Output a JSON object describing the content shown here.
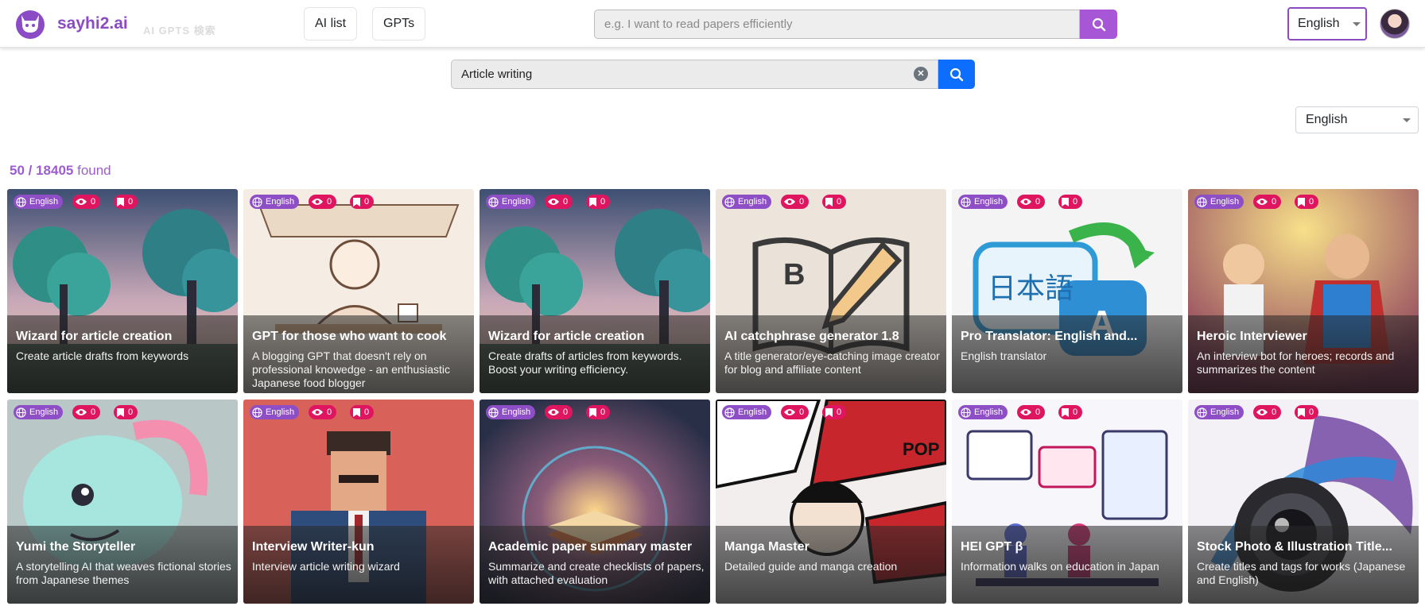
{
  "header": {
    "brand": "sayhi2.ai",
    "ghost_text": "AI GPTS 検索",
    "nav": [
      "AI list",
      "GPTs"
    ],
    "search_placeholder": "e.g. I want to read papers efficiently",
    "language": "English"
  },
  "search": {
    "query": "Article writing",
    "language": "English"
  },
  "results": {
    "shown": "50 / 18405",
    "suffix": "found"
  },
  "colors": {
    "brand": "#8b4bc5",
    "primary": "#0d6efd",
    "badge_pink": "#e0155f",
    "badge_purple": "#8e4ec6"
  },
  "cards": [
    {
      "lang": "English",
      "views": "0",
      "saves": "0",
      "title": "Wizard for article creation",
      "desc": "Create article drafts from keywords",
      "art": "forest-dusk"
    },
    {
      "lang": "English",
      "views": "0",
      "saves": "0",
      "title": "GPT for those who want to cook",
      "desc": "A blogging GPT that doesn't rely on professional knowedge - an enthusiastic Japanese food blogger",
      "art": "sketch-writer"
    },
    {
      "lang": "English",
      "views": "0",
      "saves": "0",
      "title": "Wizard for article creation",
      "desc": "Create drafts of articles from keywords. Boost your writing efficiency.",
      "art": "forest-dusk"
    },
    {
      "lang": "English",
      "views": "0",
      "saves": "0",
      "title": "AI catchphrase generator 1.8",
      "desc": "A title generator/eye-catching image creator for blog and affiliate content",
      "art": "book-pencil"
    },
    {
      "lang": "English",
      "views": "0",
      "saves": "0",
      "title": "Pro Translator: English and...",
      "desc": "English translator",
      "art": "translate-bubbles"
    },
    {
      "lang": "English",
      "views": "0",
      "saves": "0",
      "title": "Heroic Interviewer",
      "desc": "An interview bot for heroes; records and summarizes the content",
      "art": "hero-stage"
    },
    {
      "lang": "English",
      "views": "0",
      "saves": "0",
      "title": "Yumi the Storyteller",
      "desc": "A storytelling AI that weaves fictional stories from Japanese themes",
      "art": "pastel-creature"
    },
    {
      "lang": "English",
      "views": "0",
      "saves": "0",
      "title": "Interview Writer-kun",
      "desc": "Interview article writing wizard",
      "art": "pixel-man"
    },
    {
      "lang": "English",
      "views": "0",
      "saves": "0",
      "title": "Academic paper summary master",
      "desc": "Summarize and create checklists of papers, with attached evaluation",
      "art": "glowing-book"
    },
    {
      "lang": "English",
      "views": "0",
      "saves": "0",
      "title": "Manga Master",
      "desc": "Detailed guide and manga creation",
      "art": "manga-panels"
    },
    {
      "lang": "English",
      "views": "0",
      "saves": "0",
      "title": "HEI GPT β",
      "desc": "Information walks on education in Japan",
      "art": "edu-infographic"
    },
    {
      "lang": "English",
      "views": "0",
      "saves": "0",
      "title": "Stock Photo & Illustration Title...",
      "desc": "Create titles and tags for works (Japanese and English)",
      "art": "camera-lens"
    }
  ]
}
